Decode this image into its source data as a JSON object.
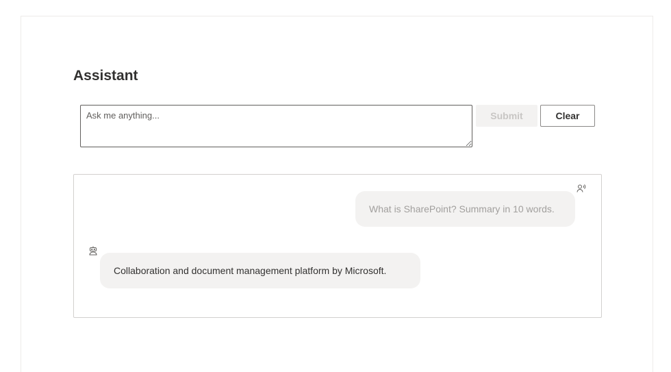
{
  "assistant": {
    "title": "Assistant",
    "prompt": {
      "value": "",
      "placeholder": "Ask me anything..."
    },
    "submit_label": "Submit",
    "clear_label": "Clear",
    "submit_disabled": true
  },
  "conversation": {
    "messages": [
      {
        "role": "user",
        "icon": "person-voice-icon",
        "text": "What is SharePoint? Summary in 10 words."
      },
      {
        "role": "assistant",
        "icon": "bot-icon",
        "text": "Collaboration and document management platform by Microsoft."
      }
    ]
  },
  "colors": {
    "text": "#323130",
    "user_text": "#a19f9d",
    "bubble_bg": "#f3f2f1",
    "border": "#d2d0ce",
    "disabled_text": "#c8c6c4"
  }
}
